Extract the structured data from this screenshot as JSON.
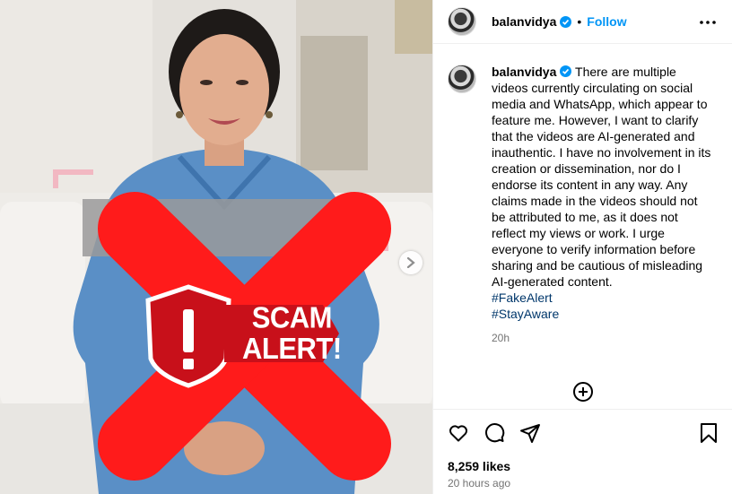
{
  "media": {
    "overlay_line1": "SCAM",
    "overlay_line2": "ALERT!",
    "next_icon": "chevron-right-icon"
  },
  "header": {
    "username": "balanvidya",
    "dot": "•",
    "follow_label": "Follow",
    "more_icon": "more-options-icon"
  },
  "caption": {
    "username": "balanvidya",
    "text": "There are multiple videos currently circulating on social media and WhatsApp, which appear to feature me. However, I want to clarify that the videos are AI-generated and inauthentic. I have no involvement in its creation or dissemination, nor do I endorse its content in any way. Any claims made in the videos should not be attributed to me, as it does not reflect my views or work. I urge everyone to verify information before sharing and be cautious of misleading AI-generated content.",
    "hashtags": [
      "#FakeAlert",
      "#StayAware"
    ],
    "time": "20h"
  },
  "actions": {
    "likes": "8,259 likes",
    "posted": "20 hours ago"
  },
  "colors": {
    "accent": "#0095f6",
    "hashtag": "#00376b",
    "alert_red": "#ff1b1b"
  }
}
